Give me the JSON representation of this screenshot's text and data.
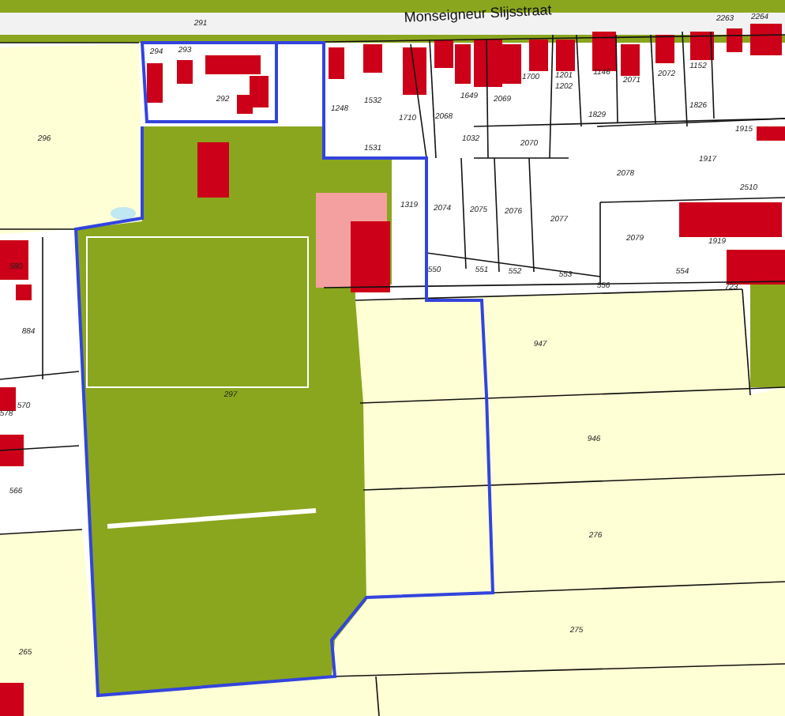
{
  "map": {
    "street_name": "Monseigneur Slijsstraat",
    "parcels": [
      {
        "number": "291"
      },
      {
        "number": "294"
      },
      {
        "number": "293"
      },
      {
        "number": "292"
      },
      {
        "number": "296"
      },
      {
        "number": "1248"
      },
      {
        "number": "1532"
      },
      {
        "number": "1531"
      },
      {
        "number": "1710"
      },
      {
        "number": "2068"
      },
      {
        "number": "1649"
      },
      {
        "number": "2069"
      },
      {
        "number": "1032"
      },
      {
        "number": "1700"
      },
      {
        "number": "1201"
      },
      {
        "number": "1202"
      },
      {
        "number": "1146"
      },
      {
        "number": "2071"
      },
      {
        "number": "2072"
      },
      {
        "number": "1152"
      },
      {
        "number": "1826"
      },
      {
        "number": "1829"
      },
      {
        "number": "2070"
      },
      {
        "number": "2263"
      },
      {
        "number": "2264"
      },
      {
        "number": "1915"
      },
      {
        "number": "1917"
      },
      {
        "number": "2078"
      },
      {
        "number": "2510"
      },
      {
        "number": "1319"
      },
      {
        "number": "2074"
      },
      {
        "number": "2075"
      },
      {
        "number": "2076"
      },
      {
        "number": "2077"
      },
      {
        "number": "2079"
      },
      {
        "number": "1919"
      },
      {
        "number": "550"
      },
      {
        "number": "551"
      },
      {
        "number": "552"
      },
      {
        "number": "553"
      },
      {
        "number": "556"
      },
      {
        "number": "554"
      },
      {
        "number": "723"
      },
      {
        "number": "947"
      },
      {
        "number": "946"
      },
      {
        "number": "276"
      },
      {
        "number": "275"
      },
      {
        "number": "297"
      },
      {
        "number": "884"
      },
      {
        "number": "570"
      },
      {
        "number": "578"
      },
      {
        "number": "566"
      },
      {
        "number": "265"
      },
      {
        "number": "580"
      }
    ]
  }
}
